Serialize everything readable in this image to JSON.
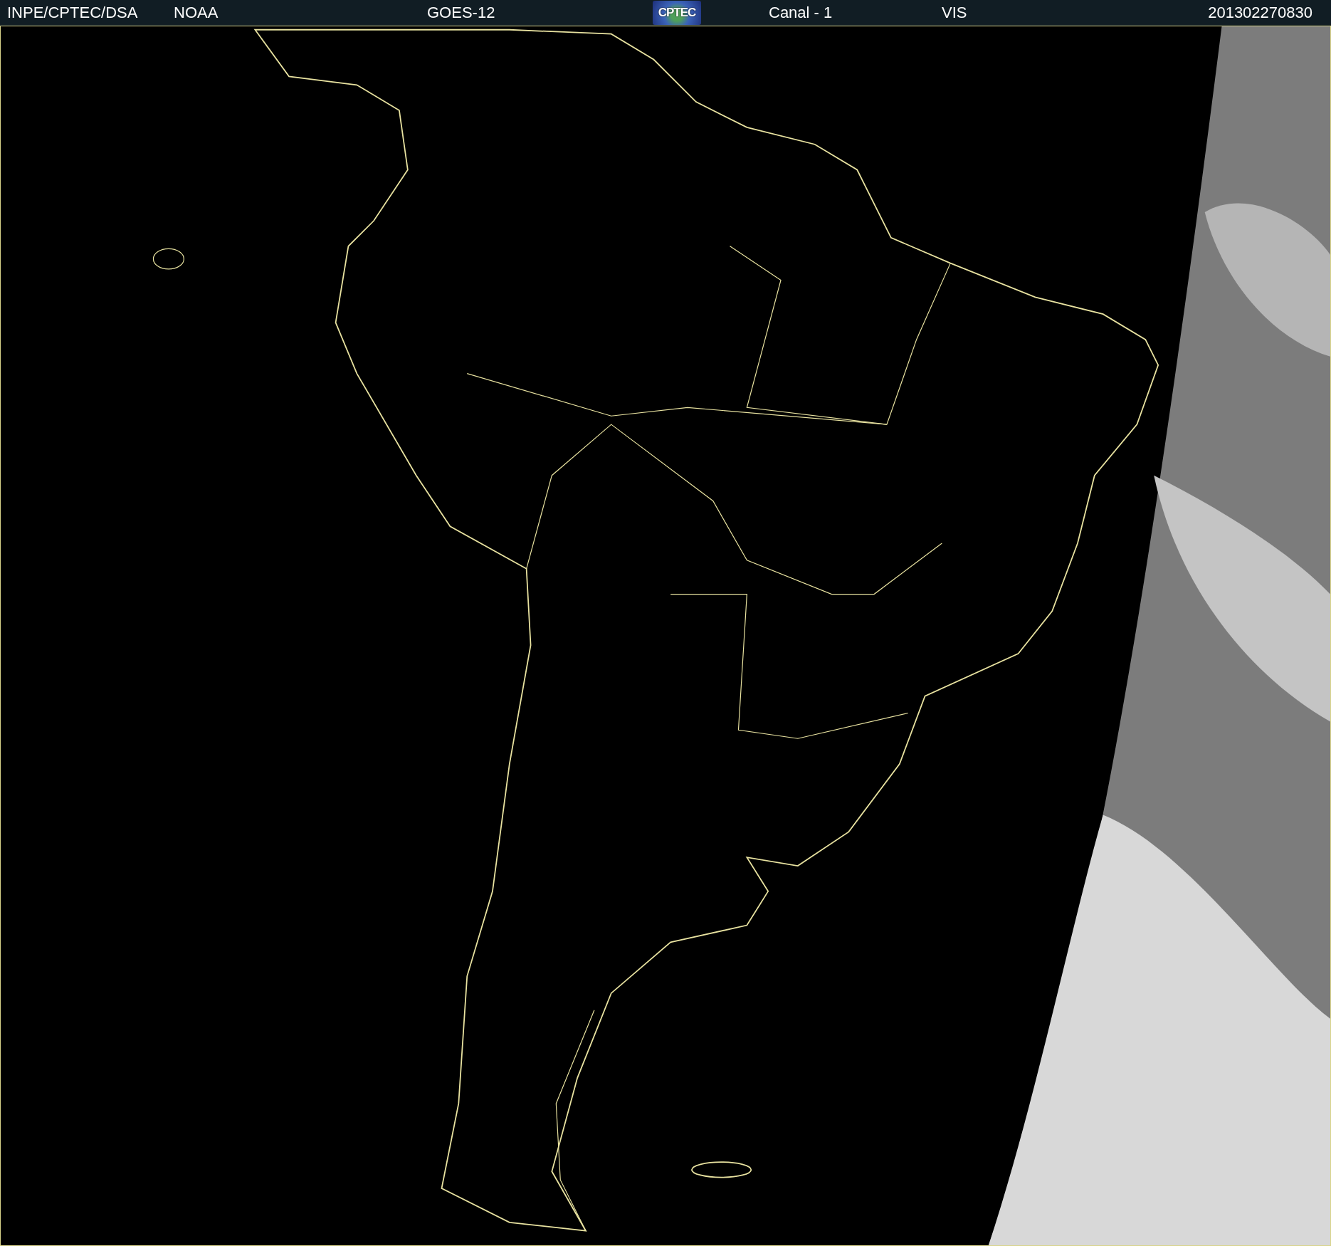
{
  "header": {
    "source": "INPE/CPTEC/DSA",
    "agency": "NOAA",
    "satellite": "GOES-12",
    "logo": "CPTEC",
    "channel": "Canal - 1",
    "band": "VIS",
    "timestamp": "201302270830"
  }
}
